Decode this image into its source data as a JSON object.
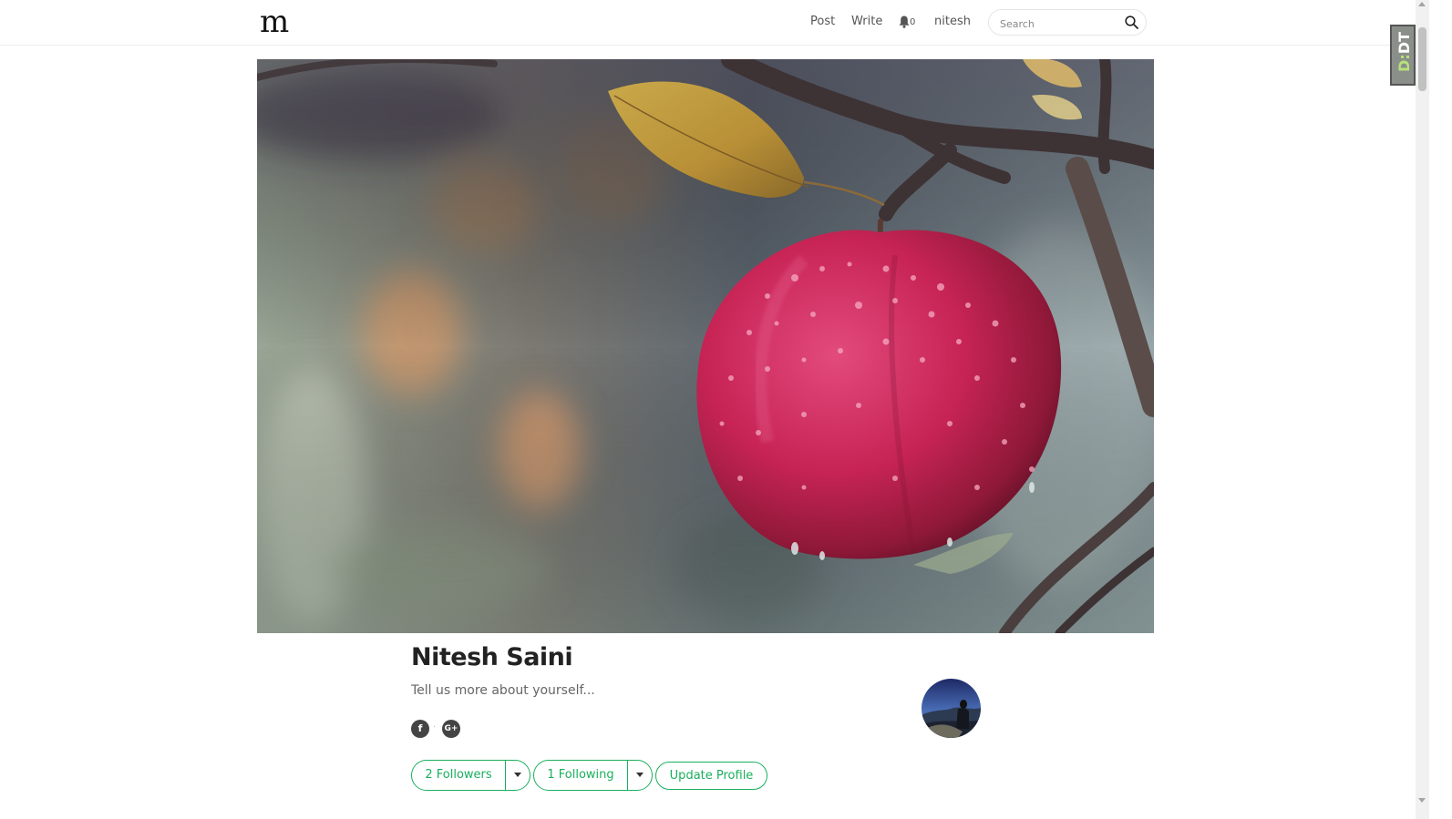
{
  "nav": {
    "logo": "m",
    "post": "Post",
    "write": "Write",
    "notification_count": "0",
    "username": "nitesh",
    "search_placeholder": "Search"
  },
  "extension_badge": {
    "prefix": "D:",
    "suffix": "DT"
  },
  "hero": {
    "icon": "apple-photo"
  },
  "profile": {
    "name": "Nitesh Saini",
    "bio": "Tell us more about yourself...",
    "social": {
      "facebook": "f",
      "separator": "·",
      "google_plus": "G+"
    },
    "followers_label": "2 Followers",
    "following_label": "1 Following",
    "update_label": "Update Profile"
  },
  "colors": {
    "accent": "#1aaf5d"
  }
}
